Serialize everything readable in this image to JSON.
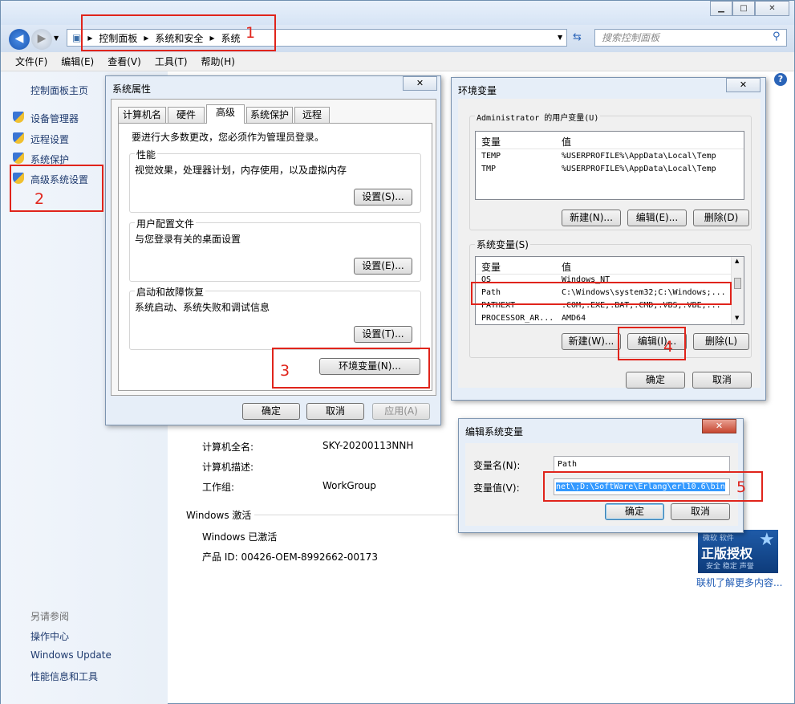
{
  "explorer": {
    "breadcrumb": [
      "控制面板",
      "系统和安全",
      "系统"
    ],
    "search_placeholder": "搜索控制面板",
    "menu": [
      "文件(F)",
      "编辑(E)",
      "查看(V)",
      "工具(T)",
      "帮助(H)"
    ],
    "sidebar": {
      "home": "控制面板主页",
      "items": [
        "设备管理器",
        "远程设置",
        "系统保护",
        "高级系统设置"
      ],
      "see_also_title": "另请参阅",
      "see_also": [
        "操作中心",
        "Windows Update",
        "性能信息和工具"
      ]
    },
    "main": {
      "computer_full_name_label": "计算机全名:",
      "computer_full_name": "SKY-20200113NNH",
      "computer_desc_label": "计算机描述:",
      "workgroup_label": "工作组:",
      "workgroup": "WorkGroup",
      "activation_title": "Windows 激活",
      "activated": "Windows 已激活",
      "product_id": "产品 ID: 00426-OEM-8992662-00173",
      "badge_top": "微软 软件",
      "badge_main": "正版授权",
      "badge_bottom": "安全 稳定 声誉",
      "more_link": "联机了解更多内容..."
    }
  },
  "sysprops": {
    "title": "系统属性",
    "tabs": [
      "计算机名",
      "硬件",
      "高级",
      "系统保护",
      "远程"
    ],
    "admin_note": "要进行大多数更改，您必须作为管理员登录。",
    "performance": {
      "title": "性能",
      "desc": "视觉效果，处理器计划，内存使用，以及虚拟内存",
      "button": "设置(S)..."
    },
    "profile": {
      "title": "用户配置文件",
      "desc": "与您登录有关的桌面设置",
      "button": "设置(E)..."
    },
    "startup": {
      "title": "启动和故障恢复",
      "desc": "系统启动、系统失败和调试信息",
      "button": "设置(T)..."
    },
    "env_button": "环境变量(N)...",
    "ok": "确定",
    "cancel": "取消",
    "apply": "应用(A)"
  },
  "envvars": {
    "title": "环境变量",
    "user_group": "Administrator 的用户变量(U)",
    "col_var": "变量",
    "col_val": "值",
    "user_rows": [
      {
        "name": "TEMP",
        "value": "%USERPROFILE%\\AppData\\Local\\Temp"
      },
      {
        "name": "TMP",
        "value": "%USERPROFILE%\\AppData\\Local\\Temp"
      }
    ],
    "user_buttons": [
      "新建(N)...",
      "编辑(E)...",
      "删除(D)"
    ],
    "sys_group": "系统变量(S)",
    "sys_rows": [
      {
        "name": "OS",
        "value": "Windows_NT"
      },
      {
        "name": "Path",
        "value": "C:\\Windows\\system32;C:\\Windows;..."
      },
      {
        "name": "PATHEXT",
        "value": ".COM;.EXE;.BAT;.CMD;.VBS;.VBE;..."
      },
      {
        "name": "PROCESSOR_AR...",
        "value": "AMD64"
      }
    ],
    "sys_buttons": [
      "新建(W)...",
      "编辑(I)...",
      "删除(L)"
    ],
    "ok": "确定",
    "cancel": "取消"
  },
  "editvar": {
    "title": "编辑系统变量",
    "name_label": "变量名(N):",
    "name_value": "Path",
    "value_label": "变量值(V):",
    "value_value": "net\\;D:\\SoftWare\\Erlang\\erl10.6\\bin",
    "ok": "确定",
    "cancel": "取消"
  },
  "annotations": [
    "1",
    "2",
    "3",
    "4",
    "5"
  ]
}
